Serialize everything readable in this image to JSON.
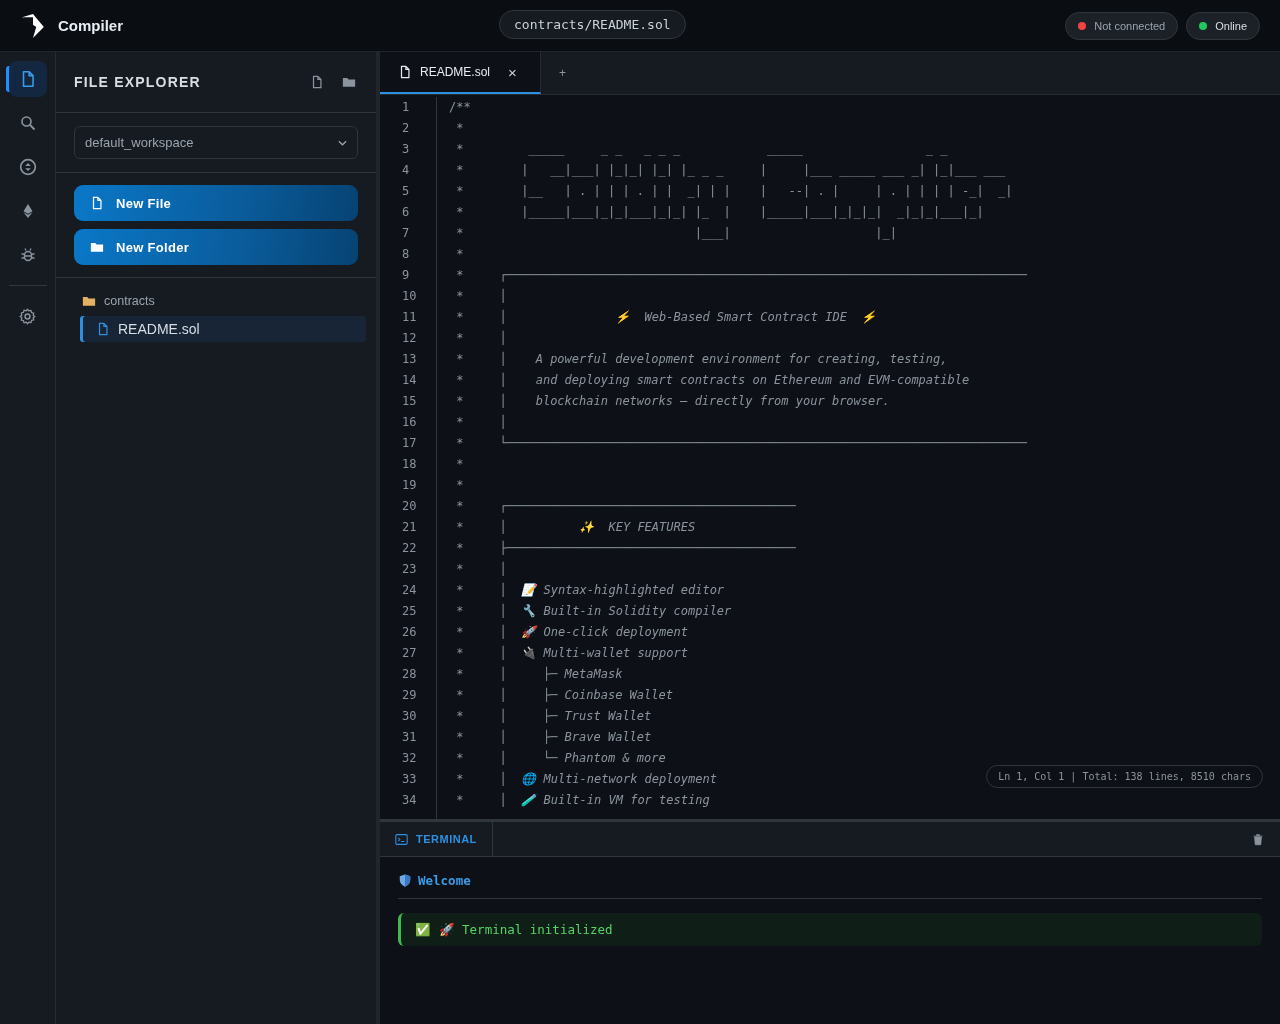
{
  "header": {
    "title": "Compiler",
    "path": "contracts/README.sol",
    "statuses": [
      {
        "label": "Not connected",
        "color": "#ef4444"
      },
      {
        "label": "Online",
        "color": "#22c55e"
      }
    ]
  },
  "activity_bar": [
    {
      "selected": true
    },
    {
      "selected": false
    },
    {
      "selected": false
    },
    {
      "selected": false
    },
    {
      "selected": false
    },
    {
      "selected": false
    }
  ],
  "sidebar": {
    "title": "FILE EXPLORER",
    "workspace": "default_workspace",
    "buttons": [
      {
        "label": "New File"
      },
      {
        "label": "New Folder"
      }
    ],
    "tree": [
      {
        "name": "contracts",
        "kind": "folder",
        "selected": false,
        "children": [
          {
            "name": "README.sol",
            "kind": "file",
            "selected": true
          }
        ]
      }
    ]
  },
  "tabs": [
    {
      "label": "README.sol",
      "close": "×",
      "selected": true
    },
    {
      "label": "+",
      "selected": false
    }
  ],
  "editor": {
    "lines": [
      {
        "number": "1",
        "kind": "art",
        "text": "/**"
      },
      {
        "number": "2",
        "kind": "art",
        "text": " *"
      },
      {
        "number": "3",
        "kind": "art",
        "text": " *         _____     _ _   _ _ _            _____                 _ _"
      },
      {
        "number": "4",
        "kind": "art",
        "text": " *        |   __|___| |_|_| |_| |_ _ _     |     |___ _____ ___ _| |_|___ ___"
      },
      {
        "number": "5",
        "kind": "art",
        "text": " *        |__   | . | | | . | |  _| | |    |   --| . |     | . | | | | -_|  _|"
      },
      {
        "number": "6",
        "kind": "art",
        "text": " *        |_____|___|_|_|___|_|_| |_  |    |_____|___|_|_|_|  _|_|_|___|_|"
      },
      {
        "number": "7",
        "kind": "art",
        "text": " *                                |___|                    |_|"
      },
      {
        "number": "8",
        "kind": "art",
        "text": " *"
      },
      {
        "number": "9",
        "kind": "art",
        "text": " *     ┌────────────────────────────────────────────────────────────────────────"
      },
      {
        "number": "10",
        "kind": "art",
        "text": " *     │"
      },
      {
        "number": "11",
        "kind": "text",
        "text": " *     │               ⚡  Web-Based Smart Contract IDE  ⚡"
      },
      {
        "number": "12",
        "kind": "art",
        "text": " *     │"
      },
      {
        "number": "13",
        "kind": "text",
        "text": " *     │    A powerful development environment for creating, testing,"
      },
      {
        "number": "14",
        "kind": "text",
        "text": " *     │    and deploying smart contracts on Ethereum and EVM-compatible"
      },
      {
        "number": "15",
        "kind": "text",
        "text": " *     │    blockchain networks — directly from your browser."
      },
      {
        "number": "16",
        "kind": "art",
        "text": " *     │"
      },
      {
        "number": "17",
        "kind": "art",
        "text": " *     └────────────────────────────────────────────────────────────────────────"
      },
      {
        "number": "18",
        "kind": "art",
        "text": " *"
      },
      {
        "number": "19",
        "kind": "art",
        "text": " *"
      },
      {
        "number": "20",
        "kind": "art",
        "text": " *     ┌────────────────────────────────────────"
      },
      {
        "number": "21",
        "kind": "text",
        "text": " *     │          ✨  KEY FEATURES"
      },
      {
        "number": "22",
        "kind": "art",
        "text": " *     ├────────────────────────────────────────"
      },
      {
        "number": "23",
        "kind": "art",
        "text": " *     │"
      },
      {
        "number": "24",
        "kind": "text",
        "text": " *     │  📝 Syntax-highlighted editor"
      },
      {
        "number": "25",
        "kind": "text",
        "text": " *     │  🔧 Built-in Solidity compiler"
      },
      {
        "number": "26",
        "kind": "text",
        "text": " *     │  🚀 One-click deployment"
      },
      {
        "number": "27",
        "kind": "text",
        "text": " *     │  🔌 Multi-wallet support"
      },
      {
        "number": "28",
        "kind": "text",
        "text": " *     │     ├─ MetaMask"
      },
      {
        "number": "29",
        "kind": "text",
        "text": " *     │     ├─ Coinbase Wallet"
      },
      {
        "number": "30",
        "kind": "text",
        "text": " *     │     ├─ Trust Wallet"
      },
      {
        "number": "31",
        "kind": "text",
        "text": " *     │     ├─ Brave Wallet"
      },
      {
        "number": "32",
        "kind": "text",
        "text": " *     │     └─ Phantom & more"
      },
      {
        "number": "33",
        "kind": "text",
        "text": " *     │  🌐 Multi-network deployment"
      },
      {
        "number": "34",
        "kind": "text",
        "text": " *     │  🧪 Built-in VM for testing"
      }
    ],
    "status": "Ln 1, Col 1 | Total: 138 lines, 8510 chars"
  },
  "terminal": {
    "tab": "TERMINAL",
    "section": "Welcome",
    "entries": [
      {
        "text": "✅ 🚀 Terminal initialized"
      }
    ]
  }
}
